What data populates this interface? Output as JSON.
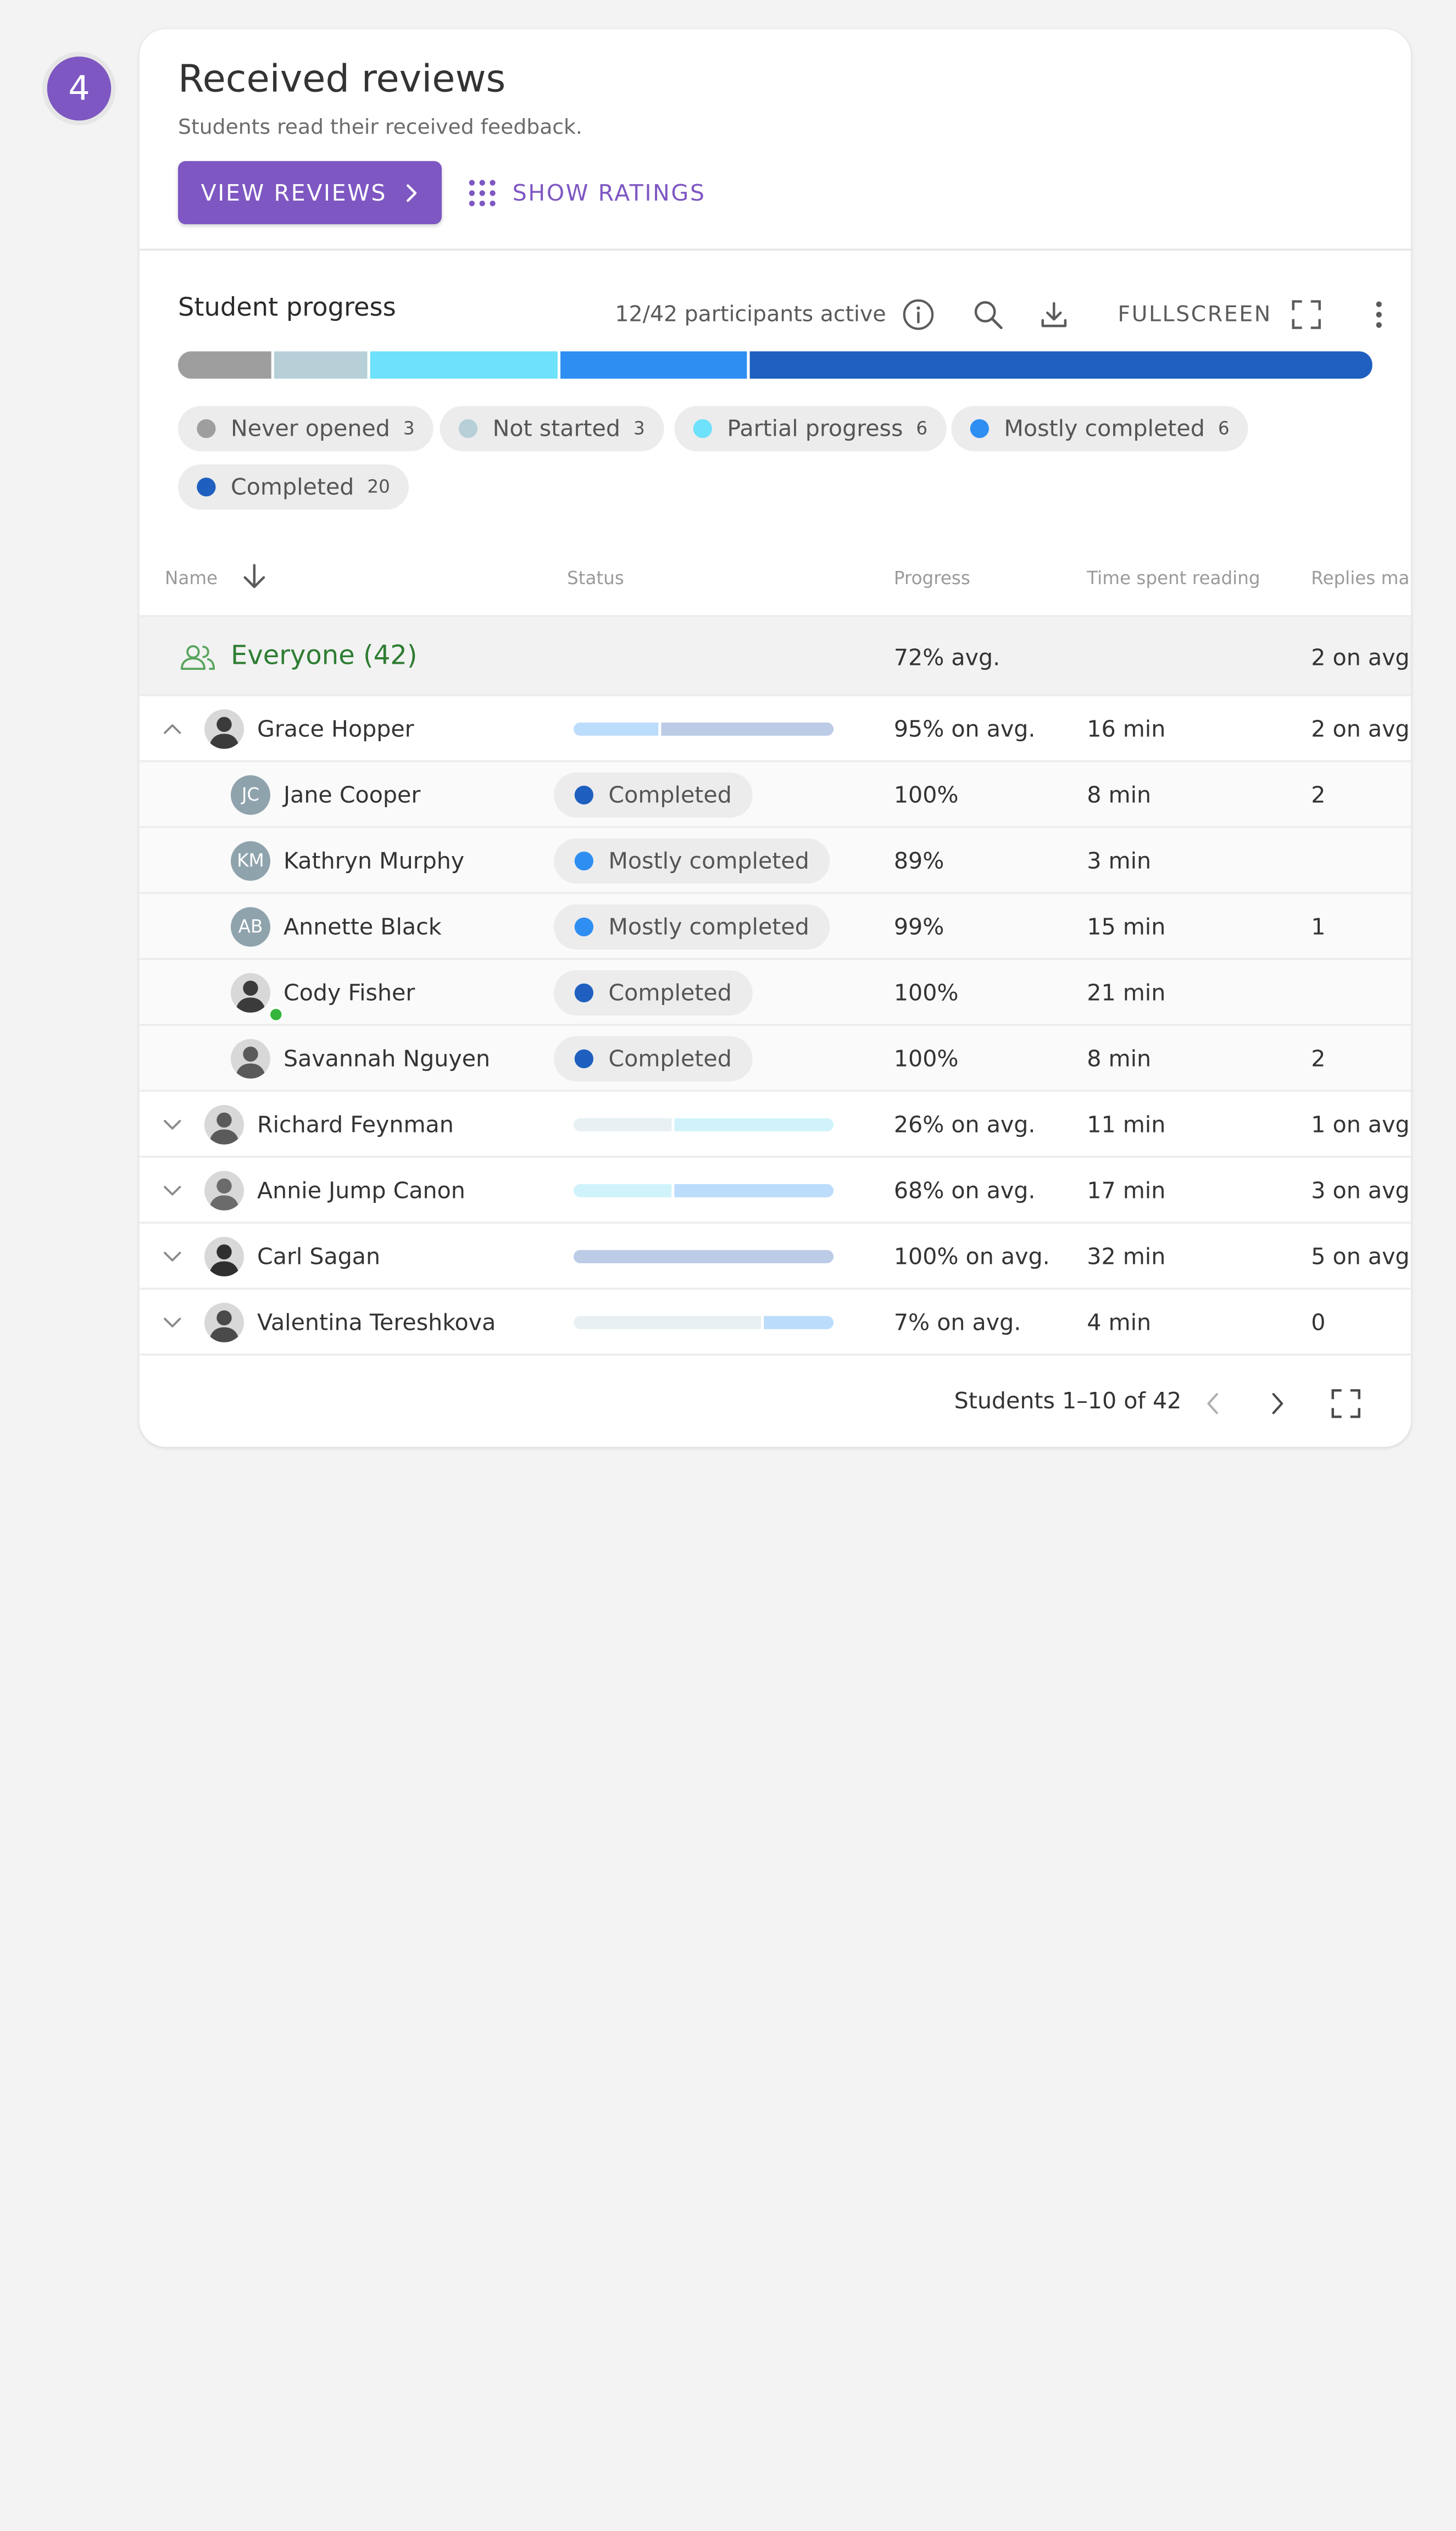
{
  "step_number": "4",
  "header": {
    "title": "Received reviews",
    "subtitle": "Students read their received feedback.",
    "view_reviews_label": "VIEW REVIEWS",
    "show_ratings_label": "SHOW RATINGS"
  },
  "progress": {
    "title": "Student progress",
    "active_text": "12/42 participants active",
    "fullscreen_label": "FULLSCREEN",
    "segments": [
      {
        "name": "Never opened",
        "count": 3,
        "color": "#9e9e9e"
      },
      {
        "name": "Not started",
        "count": 3,
        "color": "#b7cfd7"
      },
      {
        "name": "Partial progress",
        "count": 6,
        "color": "#6ee1fb"
      },
      {
        "name": "Mostly completed",
        "count": 6,
        "color": "#2e8ef2"
      },
      {
        "name": "Completed",
        "count": 20,
        "color": "#1f5fbf"
      }
    ],
    "chips": [
      {
        "label": "Never opened",
        "count": "3",
        "color": "#9e9e9e"
      },
      {
        "label": "Not started",
        "count": "3",
        "color": "#b7cfd7"
      },
      {
        "label": "Partial progress",
        "count": "6",
        "color": "#6ee1fb"
      },
      {
        "label": "Mostly completed",
        "count": "6",
        "color": "#2e8ef2"
      },
      {
        "label": "Completed",
        "count": "20",
        "color": "#1f5fbf"
      }
    ]
  },
  "table": {
    "columns": [
      "Name",
      "Status",
      "Progress",
      "Time spent reading",
      "Replies ma"
    ],
    "everyone": {
      "label": "Everyone (42)",
      "progress": "72% avg.",
      "replies": "2 on avg."
    },
    "groups": [
      {
        "name": "Grace Hopper",
        "progress": "95% on avg.",
        "time": "16 min",
        "replies": "2 on avg.",
        "expanded": true,
        "bar": [
          {
            "value": 0.33,
            "color": "#bcdcfb"
          },
          {
            "value": 0.67,
            "color": "#bccbe6"
          }
        ],
        "members": [
          {
            "name": "Jane Cooper",
            "initials": "JC",
            "status": "Completed",
            "status_color": "#1f5fbf",
            "progress": "100%",
            "time": "8 min",
            "replies": "2"
          },
          {
            "name": "Kathryn Murphy",
            "initials": "KM",
            "status": "Mostly completed",
            "status_color": "#2e8ef2",
            "progress": "89%",
            "time": "3 min",
            "replies": ""
          },
          {
            "name": "Annette Black",
            "initials": "AB",
            "status": "Mostly completed",
            "status_color": "#2e8ef2",
            "progress": "99%",
            "time": "15 min",
            "replies": "1"
          },
          {
            "name": "Cody Fisher",
            "initials": "",
            "status": "Completed",
            "status_color": "#1f5fbf",
            "progress": "100%",
            "time": "21 min",
            "replies": "",
            "online": true
          },
          {
            "name": "Savannah Nguyen",
            "initials": "",
            "status": "Completed",
            "status_color": "#1f5fbf",
            "progress": "100%",
            "time": "8 min",
            "replies": "2"
          }
        ]
      },
      {
        "name": "Richard Feynman",
        "progress": "26% on avg.",
        "time": "11 min",
        "replies": "1 on avg.",
        "bar": [
          {
            "value": 0.38,
            "color": "#e8f0f2"
          },
          {
            "value": 0.62,
            "color": "#d0f3fb"
          }
        ]
      },
      {
        "name": "Annie Jump Canon",
        "progress": "68% on avg.",
        "time": "17 min",
        "replies": "3 on avg.",
        "bar": [
          {
            "value": 0.38,
            "color": "#d0f3fb"
          },
          {
            "value": 0.62,
            "color": "#bcdcfb"
          }
        ]
      },
      {
        "name": "Carl Sagan",
        "progress": "100% on avg.",
        "time": "32 min",
        "replies": "5 on avg.",
        "bar": [
          {
            "value": 1.0,
            "color": "#bccbe6"
          }
        ]
      },
      {
        "name": "Valentina Tereshkova",
        "progress": "7% on avg.",
        "time": "4 min",
        "replies": "0",
        "bar": [
          {
            "value": 0.73,
            "color": "#e8f0f2"
          },
          {
            "value": 0.27,
            "color": "#bcdcfb"
          }
        ]
      }
    ],
    "pagination": "Students 1–10 of 42"
  },
  "colors": {
    "accent": "#7e57c2",
    "everyone_green": "#2e7d32",
    "avatar_grey": "#8fa3ad"
  }
}
